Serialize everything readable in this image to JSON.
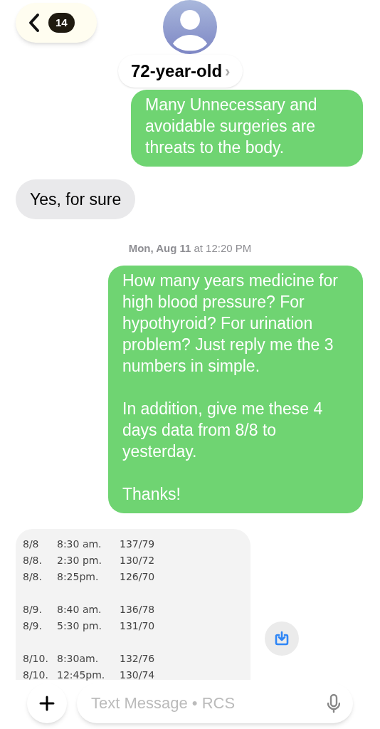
{
  "header": {
    "back_count": "14",
    "contact_name": "72-year-old",
    "chevron": "›"
  },
  "messages": [
    {
      "kind": "sent",
      "paragraphs": [
        "Many Unnecessary and avoidable surgeries are threats to the body."
      ]
    },
    {
      "kind": "received",
      "paragraphs": [
        "Yes, for sure"
      ]
    },
    {
      "kind": "timestamp",
      "day": "Mon, Aug 11",
      "time": "at 12:20 PM"
    },
    {
      "kind": "sent",
      "paragraphs": [
        "How many years medicine for high blood pressure? For hypothyroid? For urination problem? Just reply me the 3 numbers in simple.",
        "In addition, give me these 4 days data from 8/8 to yesterday.",
        "Thanks!"
      ]
    },
    {
      "kind": "attachment",
      "groups": [
        [
          {
            "date": "8/8",
            "time": "8:30 am.",
            "reading": "137/79"
          },
          {
            "date": "8/8.",
            "time": "2:30 pm.",
            "reading": "130/72"
          },
          {
            "date": "8/8.",
            "time": "8:25pm.",
            "reading": "126/70"
          }
        ],
        [
          {
            "date": "8/9.",
            "time": "8:40 am.",
            "reading": "136/78"
          },
          {
            "date": "8/9.",
            "time": "5:30 pm.",
            "reading": "131/70"
          }
        ],
        [
          {
            "date": "8/10.",
            "time": "8:30am.",
            "reading": "132/76"
          },
          {
            "date": "8/10.",
            "time": "12:45pm.",
            "reading": "130/74"
          }
        ]
      ]
    }
  ],
  "composer": {
    "placeholder": "Text Message • RCS"
  }
}
